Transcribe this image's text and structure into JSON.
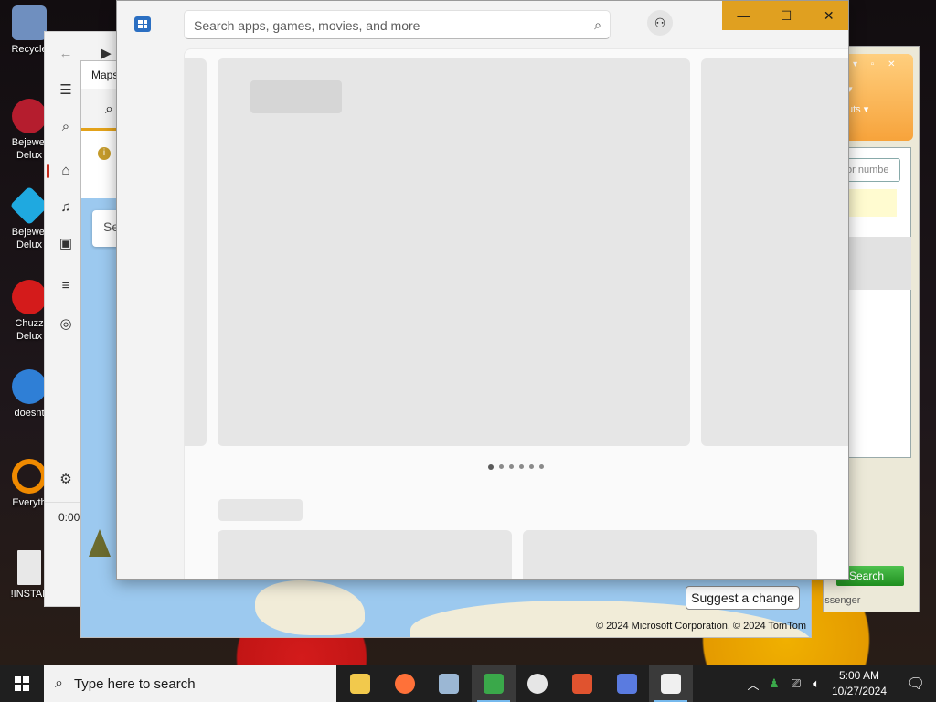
{
  "desktop": {
    "icons": [
      {
        "label": "Recycle",
        "icon": "recycle-bin-icon",
        "color": "#6f8fbf"
      },
      {
        "label": "Bejewel\nDelux",
        "icon": "bejeweled2-icon",
        "color": "#b51d2e"
      },
      {
        "label": "Bejewel\nDelux",
        "icon": "bejeweled-gem-icon",
        "color": "#1fa9e0"
      },
      {
        "label": "Chuzz\nDelux",
        "icon": "chuzzle-icon",
        "color": "#d41b1b"
      },
      {
        "label": "doesnt",
        "icon": "thunderbird-icon",
        "color": "#2f7fd6"
      },
      {
        "label": "Everyth",
        "icon": "everything-search-icon",
        "color": "#f08a00"
      },
      {
        "label": "!INSTAL",
        "icon": "text-file-icon",
        "color": "#e8e8e8"
      }
    ]
  },
  "media_player": {
    "time": "0:00"
  },
  "maps": {
    "title": "Maps",
    "search_placeholder": "Se",
    "suggest_label": "Suggest a change",
    "copyright": "© 2024 Microsoft Corporation, © 2024 TomTom"
  },
  "messenger": {
    "menu1": "▾",
    "menu2": "uts ▾",
    "input_placeholder": "or numbe",
    "link": "e",
    "search_label": "Search",
    "footer": "Messenger"
  },
  "store": {
    "search_placeholder": "Search apps, games, movies, and more",
    "carousel_dots": 6,
    "active_dot": 0
  },
  "taskbar": {
    "search_placeholder": "Type here to search",
    "apps": [
      {
        "name": "file-explorer-icon",
        "color": "#f2c94c"
      },
      {
        "name": "firefox-icon",
        "color": "#ff7139"
      },
      {
        "name": "news-app-icon",
        "color": "#9bb7d4"
      },
      {
        "name": "messenger-people-icon",
        "color": "#3aa84a"
      },
      {
        "name": "media-player-icon",
        "color": "#e6e6e6"
      },
      {
        "name": "maps-pin-icon",
        "color": "#e0532f"
      },
      {
        "name": "copilot-icon",
        "color": "#5a7be0"
      },
      {
        "name": "store-icon",
        "color": "#f0f0f0"
      }
    ],
    "clock_time": "5:00 AM",
    "clock_date": "10/27/2024"
  }
}
